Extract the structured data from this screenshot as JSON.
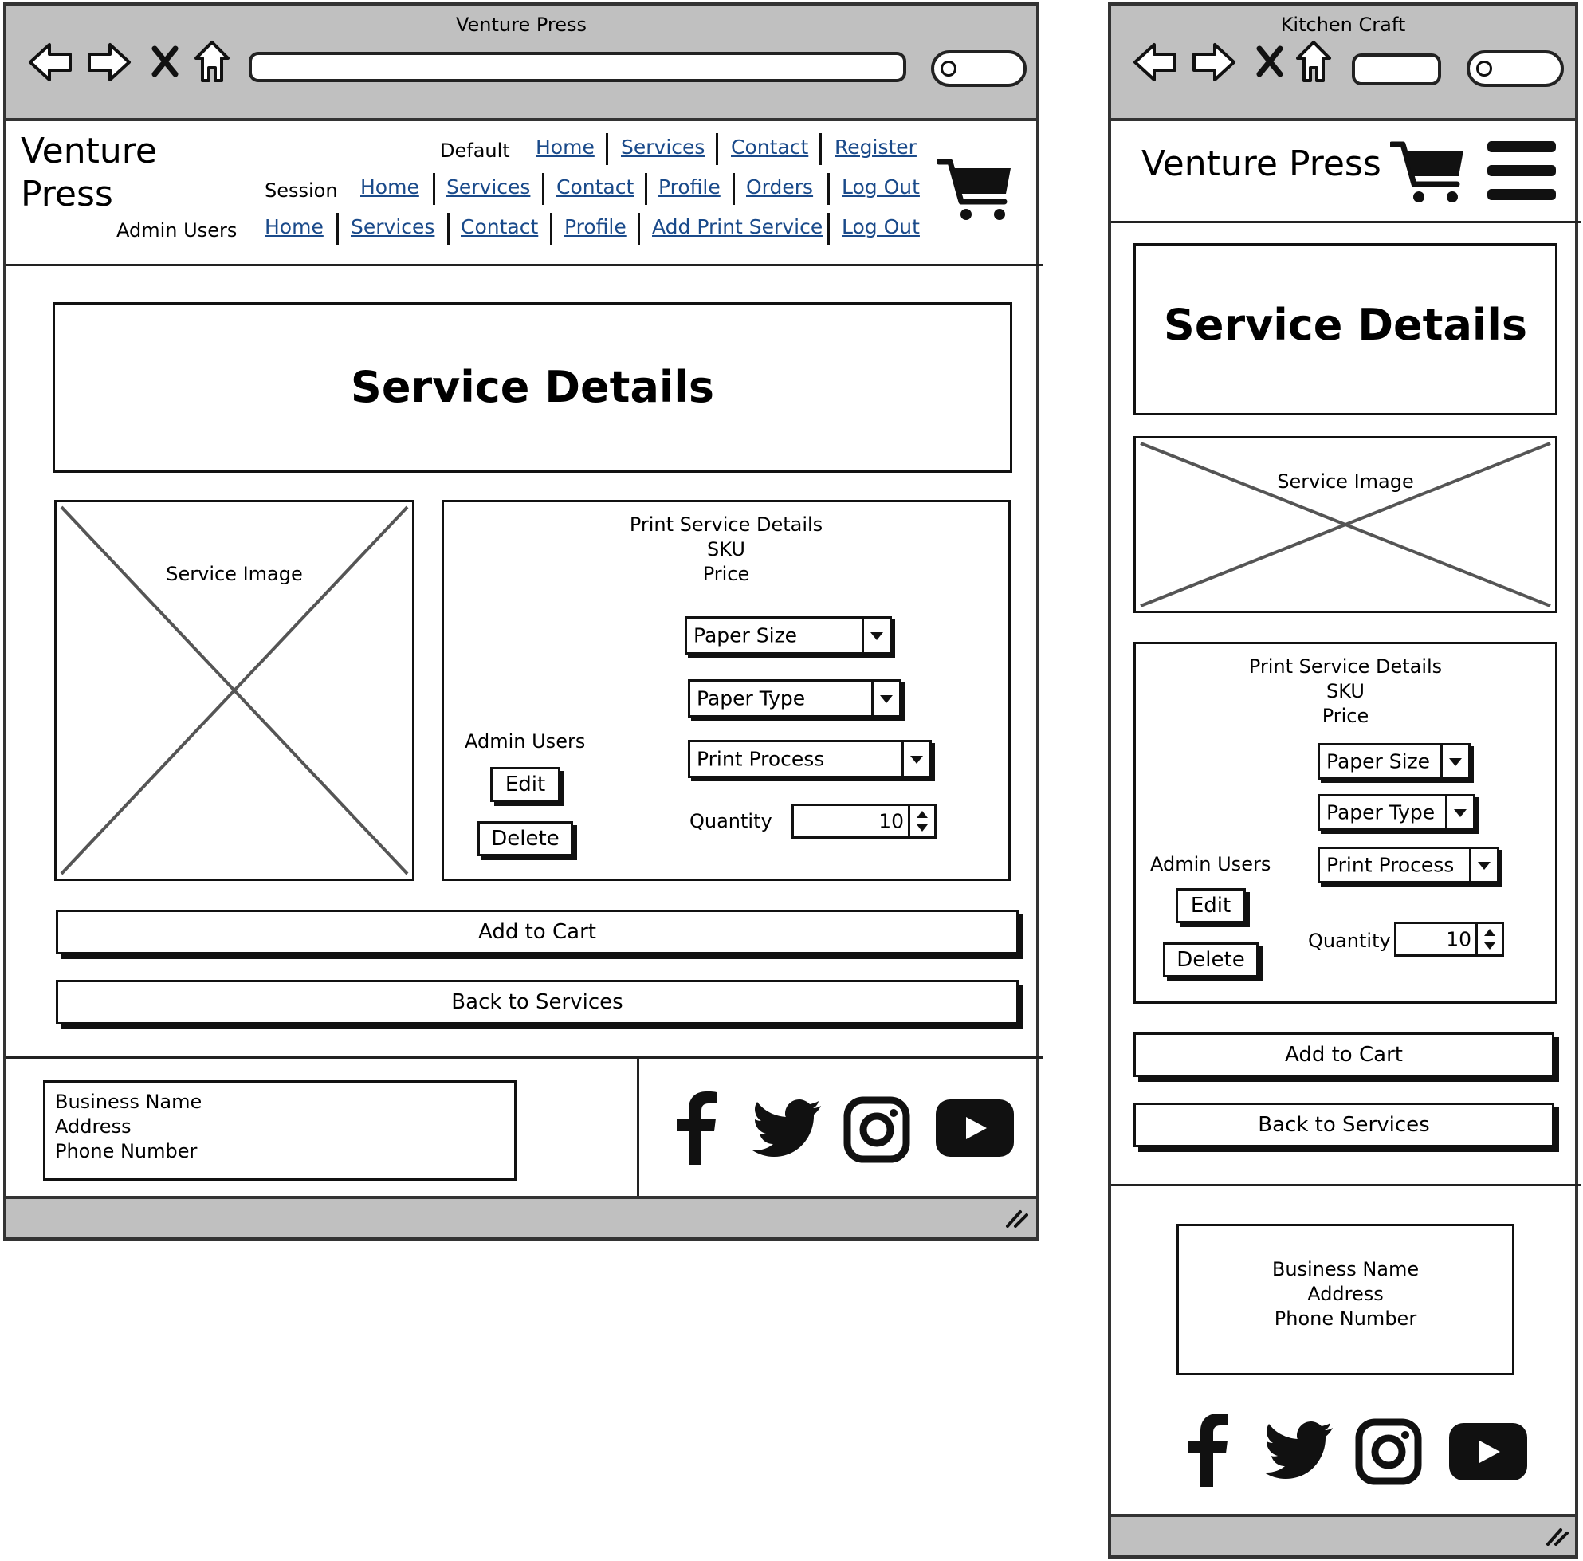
{
  "desktop": {
    "window_title": "Venture Press",
    "logo": "Venture Press",
    "nav": {
      "default_label": "Default",
      "default_links": [
        "Home",
        "Services",
        "Contact",
        "Register"
      ],
      "session_label": "Session",
      "session_links": [
        "Home",
        "Services",
        "Contact",
        "Profile",
        "Orders",
        "Log Out"
      ],
      "admin_label": "Admin Users",
      "admin_links": [
        "Home",
        "Services",
        "Contact",
        "Profile",
        "Add Print Service",
        "Log Out"
      ]
    },
    "page_heading": "Service Details",
    "service_image_label": "Service Image",
    "details": {
      "title": "Print Service Details",
      "sku": "SKU",
      "price": "Price",
      "paper_size": "Paper Size",
      "paper_type": "Paper Type",
      "print_process": "Print Process",
      "quantity_label": "Quantity",
      "quantity_value": "10",
      "admin_label": "Admin Users",
      "edit_label": "Edit",
      "delete_label": "Delete"
    },
    "add_to_cart": "Add to Cart",
    "back_to_services": "Back to Services",
    "footer": {
      "business_name": "Business Name",
      "address": "Address",
      "phone": "Phone Number"
    }
  },
  "mobile": {
    "window_title": "Kitchen Craft",
    "logo": "Venture Press",
    "page_heading": "Service Details",
    "service_image_label": "Service Image",
    "details": {
      "title": "Print Service Details",
      "sku": "SKU",
      "price": "Price",
      "paper_size": "Paper Size",
      "paper_type": "Paper Type",
      "print_process": "Print Process",
      "quantity_label": "Quantity",
      "quantity_value": "10",
      "admin_label": "Admin Users",
      "edit_label": "Edit",
      "delete_label": "Delete"
    },
    "add_to_cart": "Add to Cart",
    "back_to_services": "Back to Services",
    "footer": {
      "business_name": "Business Name",
      "address": "Address",
      "phone": "Phone Number"
    }
  },
  "icons": [
    "back-arrow-icon",
    "forward-arrow-icon",
    "close-icon",
    "home-icon",
    "search-icon",
    "cart-icon",
    "hamburger-menu-icon",
    "facebook-icon",
    "twitter-icon",
    "instagram-icon",
    "youtube-icon",
    "resize-grip-icon"
  ],
  "colors": {
    "link": "#1a4a8a",
    "chrome": "#c0c0c0"
  }
}
